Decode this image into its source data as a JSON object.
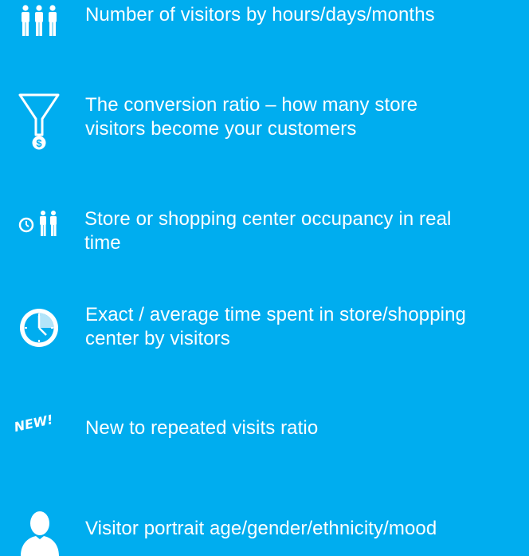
{
  "colors": {
    "background": "#00adef",
    "foreground": "#ffffff"
  },
  "features": [
    {
      "icon": "three-people-icon",
      "text": "Number of visitors by hours/days/months"
    },
    {
      "icon": "funnel-dollar-icon",
      "text": "The conversion ratio – how many store\nvisitors  become your customers"
    },
    {
      "icon": "clock-people-icon",
      "text": "Store or shopping center occupancy in real\ntime"
    },
    {
      "icon": "clock-icon",
      "text": "Exact / average time spent in store/shopping\ncenter by visitors"
    },
    {
      "icon": "new-badge-icon",
      "badge": "NEW!",
      "text": "New to repeated visits ratio"
    },
    {
      "icon": "person-bust-icon",
      "text": "Visitor portrait age/gender/ethnicity/mood"
    }
  ]
}
